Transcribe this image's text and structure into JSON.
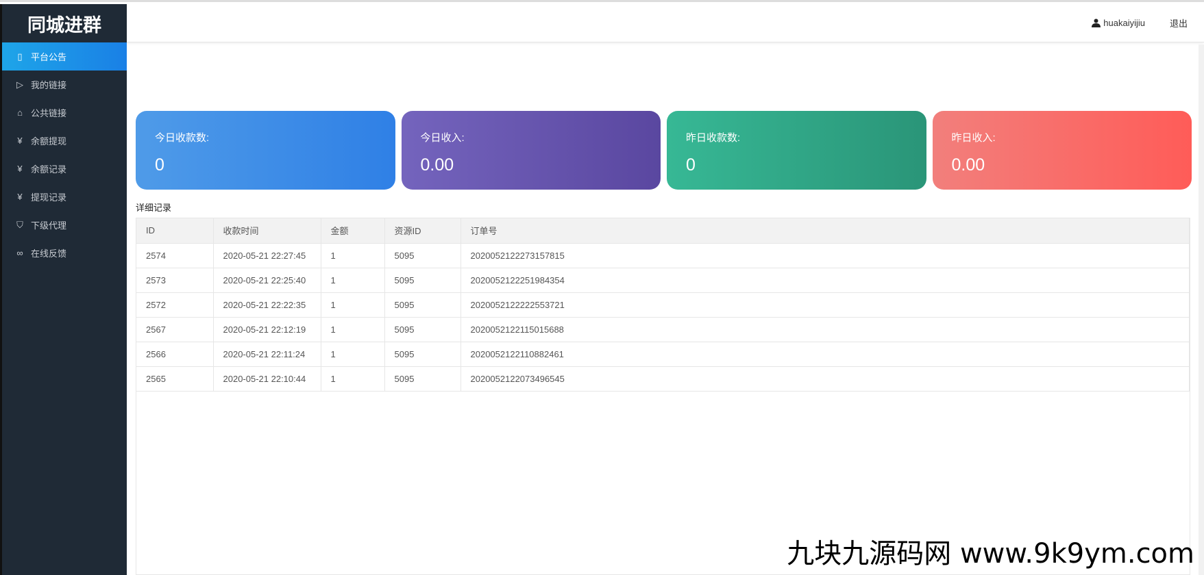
{
  "app": {
    "title": "同城进群"
  },
  "sidebar": {
    "items": [
      {
        "label": "平台公告",
        "icon": "notice-icon",
        "glyph": "▯",
        "active": true
      },
      {
        "label": "我的链接",
        "icon": "video-icon",
        "glyph": "▷"
      },
      {
        "label": "公共链接",
        "icon": "home-icon",
        "glyph": "⌂"
      },
      {
        "label": "余额提现",
        "icon": "yen-icon",
        "glyph": "¥"
      },
      {
        "label": "余额记录",
        "icon": "yen-icon",
        "glyph": "¥"
      },
      {
        "label": "提现记录",
        "icon": "yen-icon",
        "glyph": "¥"
      },
      {
        "label": "下级代理",
        "icon": "shield-icon",
        "glyph": "⛉"
      },
      {
        "label": "在线反馈",
        "icon": "link-icon",
        "glyph": "∞"
      }
    ]
  },
  "header": {
    "username": "huakaiyijiu",
    "logout": "退出"
  },
  "cards": [
    {
      "label": "今日收款数:",
      "value": "0",
      "from": "#4f9be8",
      "to": "#2f80e6"
    },
    {
      "label": "今日收入:",
      "value": "0.00",
      "from": "#7464bd",
      "to": "#5a47a0"
    },
    {
      "label": "昨日收款数:",
      "value": "0",
      "from": "#37b895",
      "to": "#2a9578"
    },
    {
      "label": "昨日收入:",
      "value": "0.00",
      "from": "#f27f7c",
      "to": "#ff5c58"
    }
  ],
  "records": {
    "title": "详细记录",
    "columns": [
      "ID",
      "收款时间",
      "金额",
      "资源ID",
      "订单号"
    ],
    "rows": [
      [
        "2574",
        "2020-05-21 22:27:45",
        "1",
        "5095",
        "2020052122273157815"
      ],
      [
        "2573",
        "2020-05-21 22:25:40",
        "1",
        "5095",
        "2020052122251984354"
      ],
      [
        "2572",
        "2020-05-21 22:22:35",
        "1",
        "5095",
        "2020052122222553721"
      ],
      [
        "2567",
        "2020-05-21 22:12:19",
        "1",
        "5095",
        "2020052122115015688"
      ],
      [
        "2566",
        "2020-05-21 22:11:24",
        "1",
        "5095",
        "2020052122110882461"
      ],
      [
        "2565",
        "2020-05-21 22:10:44",
        "1",
        "5095",
        "2020052122073496545"
      ]
    ]
  },
  "watermark": "九块九源码网 www.9k9ym.com"
}
